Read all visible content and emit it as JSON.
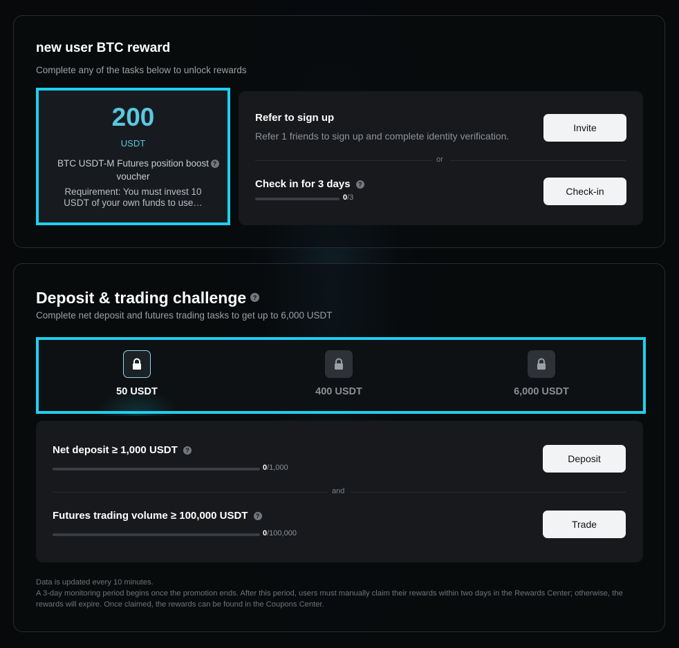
{
  "reward": {
    "title": "new user BTC reward",
    "subtitle": "Complete any of the tasks below to unlock rewards",
    "voucher": {
      "amount": "200",
      "unit": "USDT",
      "name": "BTC USDT-M Futures position boost voucher",
      "requirement": "Requirement: You must invest 10 USDT of your own funds to use…"
    },
    "tasks": [
      {
        "title": "Refer to sign up",
        "description": "Refer 1 friends to sign up and complete identity verification.",
        "button": "Invite"
      },
      {
        "title": "Check in for 3 days",
        "progress_current": "0",
        "progress_total": "/3",
        "progress_fraction": 0,
        "button": "Check-in"
      }
    ],
    "separator": "or"
  },
  "challenge": {
    "title": "Deposit & trading challenge",
    "subtitle": "Complete net deposit and futures trading tasks to get up to 6,000 USDT",
    "tiers": [
      {
        "label": "50 USDT",
        "active": true
      },
      {
        "label": "400 USDT",
        "active": false
      },
      {
        "label": "6,000 USDT",
        "active": false
      }
    ],
    "tasks": [
      {
        "title": "Net deposit ≥ 1,000 USDT",
        "progress_current": "0",
        "progress_total": "/1,000",
        "progress_fraction": 0,
        "button": "Deposit"
      },
      {
        "title": "Futures trading volume ≥ 100,000 USDT",
        "progress_current": "0",
        "progress_total": "/100,000",
        "progress_fraction": 0,
        "button": "Trade"
      }
    ],
    "separator": "and"
  },
  "footer": {
    "line1": "Data is updated every 10 minutes.",
    "line2": "A 3-day monitoring period begins once the promotion ends. After this period, users must manually claim their rewards within two days in the Rewards Center; otherwise, the rewards will expire. Once claimed, the rewards can be found in the Coupons Center."
  },
  "icons": {
    "help": "question-circle-icon",
    "lock": "lock-icon"
  },
  "colors": {
    "accent": "#1fd0f1",
    "amount": "#5bc7e0",
    "button_bg": "#f2f3f4",
    "background": "#07090b"
  }
}
